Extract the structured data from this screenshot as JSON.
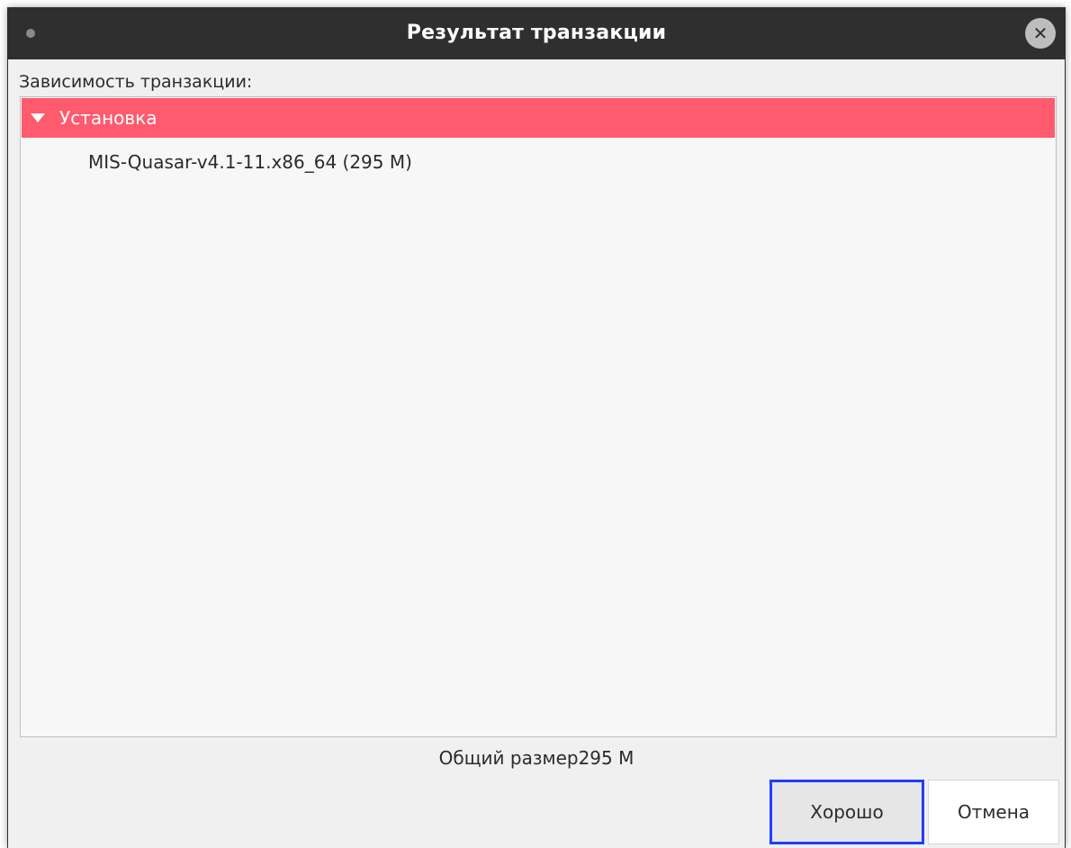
{
  "window": {
    "title": "Результат транзакции"
  },
  "dependencies": {
    "label": "Зависимость транзакции:",
    "group_label": "Установка",
    "items": [
      {
        "label": "MIS-Quasar-v4.1-11.x86_64 (295 M)"
      }
    ]
  },
  "footer": {
    "total_size_text": "Общий размер295 M",
    "ok_label": "Хорошо",
    "cancel_label": "Отмена"
  },
  "colors": {
    "titlebar": "#2f2f2f",
    "group_highlight": "#ff5a6e",
    "focus_ring": "#1f3fff"
  },
  "icons": {
    "close": "close-icon",
    "expander": "triangle-down-icon",
    "window_menu": "window-menu-dot-icon"
  }
}
